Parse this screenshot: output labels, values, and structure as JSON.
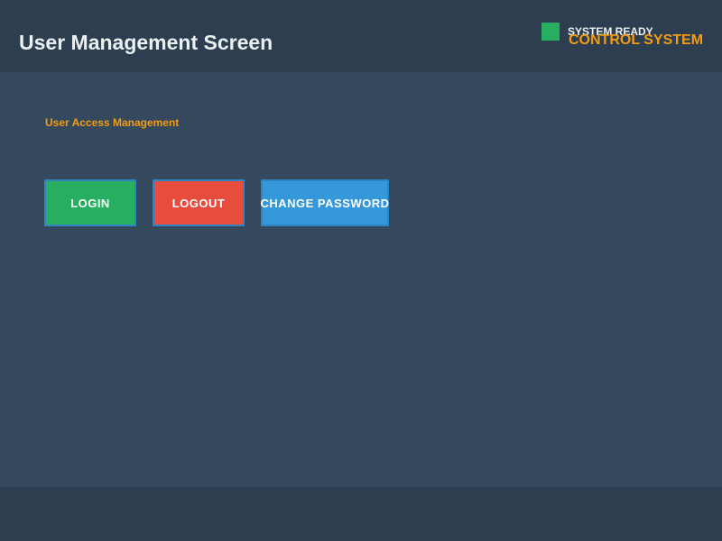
{
  "header": {
    "title": "User Management Screen",
    "status_text": "SYSTEM READY",
    "system_name": "CONTROL SYSTEM"
  },
  "main": {
    "section_label": "User Access Management",
    "buttons": {
      "login": "LOGIN",
      "logout": "LOGOUT",
      "change_password": "CHANGE PASSWORD"
    }
  },
  "colors": {
    "header_bg": "#2c3e50",
    "main_bg": "#34495e",
    "accent": "#f39c12",
    "status_ok": "#27ae60",
    "login": "#27ae60",
    "logout": "#e74c3c",
    "change_password": "#3498db"
  }
}
